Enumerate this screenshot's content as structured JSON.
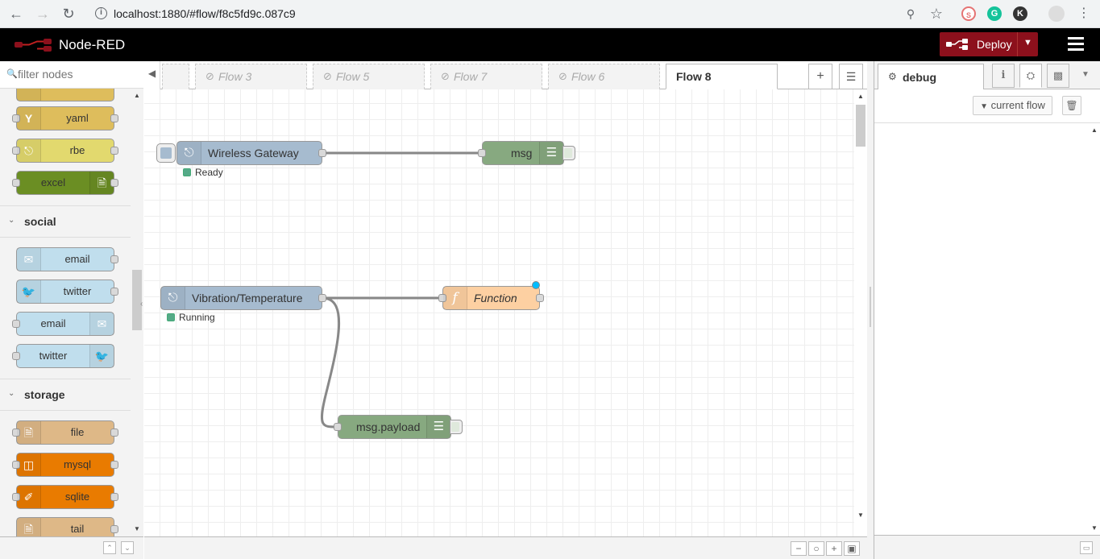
{
  "browser": {
    "url": "localhost:1880/#flow/f8c5fd9c.087c9"
  },
  "header": {
    "app_title": "Node-RED",
    "deploy_label": "Deploy",
    "accent": "#8c101c"
  },
  "palette": {
    "filter_placeholder": "filter nodes",
    "nodes_top": [
      {
        "label": "yaml",
        "color": "#debd5c"
      },
      {
        "label": "rbe",
        "color": "#e2d96e"
      },
      {
        "label": "excel",
        "color": "#6b8e23"
      }
    ],
    "categories": [
      {
        "title": "social",
        "nodes": [
          "email",
          "twitter",
          "email",
          "twitter"
        ]
      },
      {
        "title": "storage",
        "nodes": [
          "file",
          "mysql",
          "sqlite",
          "tail"
        ]
      }
    ]
  },
  "tabs": [
    {
      "label": "Flow 3",
      "disabled": true
    },
    {
      "label": "Flow 5",
      "disabled": true
    },
    {
      "label": "Flow 7",
      "disabled": true
    },
    {
      "label": "Flow 6",
      "disabled": true
    },
    {
      "label": "Flow 8",
      "active": true
    }
  ],
  "flow": {
    "nodes": [
      {
        "id": "wg",
        "label": "Wireless Gateway",
        "status": "Ready",
        "color": "#a6bbcf"
      },
      {
        "id": "msg",
        "label": "msg",
        "color": "#87a980"
      },
      {
        "id": "vt",
        "label": "Vibration/Temperature",
        "status": "Running",
        "color": "#a6bbcf"
      },
      {
        "id": "fn",
        "label": "Function",
        "color": "#fdd0a2"
      },
      {
        "id": "mp",
        "label": "msg.payload",
        "color": "#87a980"
      }
    ]
  },
  "sidebar": {
    "active_tab": "debug",
    "filter_label": "current flow"
  }
}
